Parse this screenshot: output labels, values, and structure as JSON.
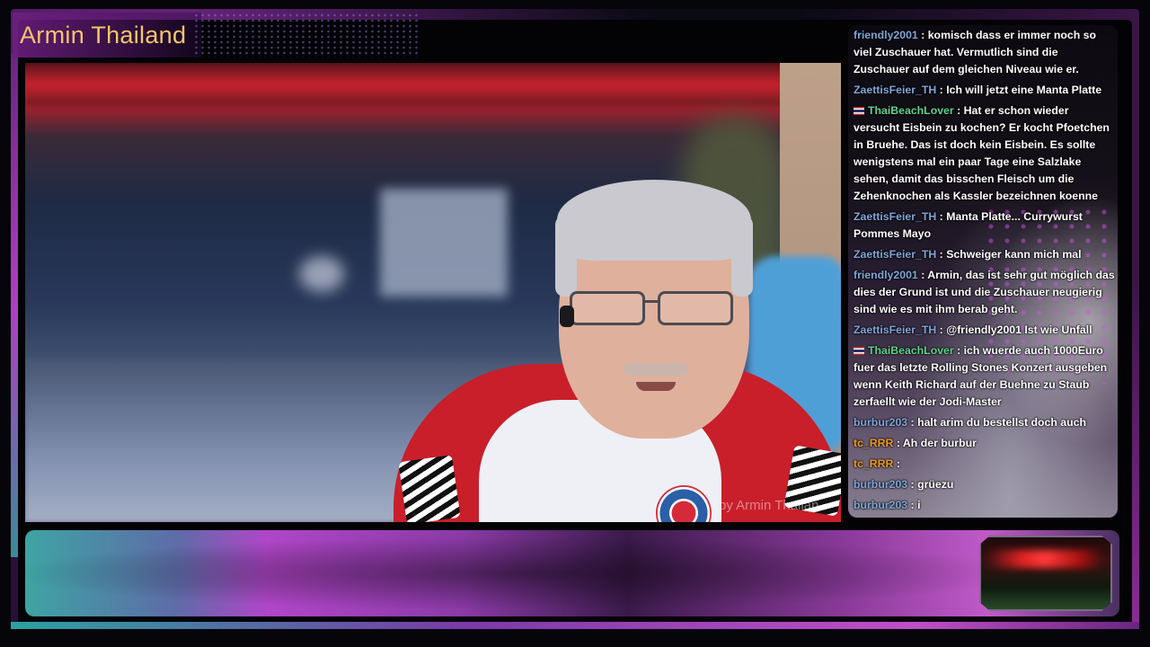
{
  "stream": {
    "title": "Armin Thailand",
    "watermark": "by Armin Thailan"
  },
  "colors": {
    "title": "#f3c56a",
    "username_default": "#7ea6d8",
    "username_green": "#5cd38c",
    "username_orange": "#f09a22",
    "message_text": "#ffffff"
  },
  "chat": {
    "messages": [
      {
        "user": "friendly2001",
        "color": "default",
        "flag": false,
        "text": "komisch dass er immer noch so viel Zuschauer hat. Vermutlich sind die Zuschauer auf dem gleichen Niveau wie er."
      },
      {
        "user": "ZaettisFeier_TH",
        "color": "default",
        "flag": false,
        "text": "Ich will jetzt eine Manta Platte"
      },
      {
        "user": "ThaiBeachLover",
        "color": "green",
        "flag": true,
        "text": "Hat er schon wieder versucht Eisbein zu kochen? Er kocht Pfoetchen in Bruehe. Das ist doch kein Eisbein. Es sollte wenigstens mal ein paar Tage eine Salzlake sehen, damit das bisschen Fleisch um die Zehenknochen als Kassler bezeichnen koenne"
      },
      {
        "user": "ZaettisFeier_TH",
        "color": "default",
        "flag": false,
        "text": "Manta Platte... Currywurst Pommes Mayo"
      },
      {
        "user": "ZaettisFeier_TH",
        "color": "default",
        "flag": false,
        "text": "Schweiger kann mich mal"
      },
      {
        "user": "friendly2001",
        "color": "default",
        "flag": false,
        "text": "Armin, das ist sehr gut möglich das dies der Grund ist und die Zuschauer neugierig sind wie es mit ihm berab geht."
      },
      {
        "user": "ZaettisFeier_TH",
        "color": "default",
        "flag": false,
        "text": "@friendly2001 Ist wie Unfall"
      },
      {
        "user": "ThaiBeachLover",
        "color": "green",
        "flag": true,
        "text": "ich wuerde auch 1000Euro fuer das letzte Rolling Stones Konzert ausgeben wenn Keith Richard auf der Buehne zu Staub zerfaellt wie der Jodi-Master"
      },
      {
        "user": "burbur203",
        "color": "default",
        "flag": false,
        "text": "halt arim du bestellst doch auch"
      },
      {
        "user": "tc_RRR",
        "color": "orange",
        "flag": false,
        "text": "Ah der burbur"
      },
      {
        "user": "tc_RRR",
        "color": "orange",
        "flag": false,
        "text": ""
      },
      {
        "user": "burbur203",
        "color": "default",
        "flag": false,
        "text": "grüezu"
      },
      {
        "user": "burbur203",
        "color": "default",
        "flag": false,
        "text": "i"
      }
    ]
  }
}
